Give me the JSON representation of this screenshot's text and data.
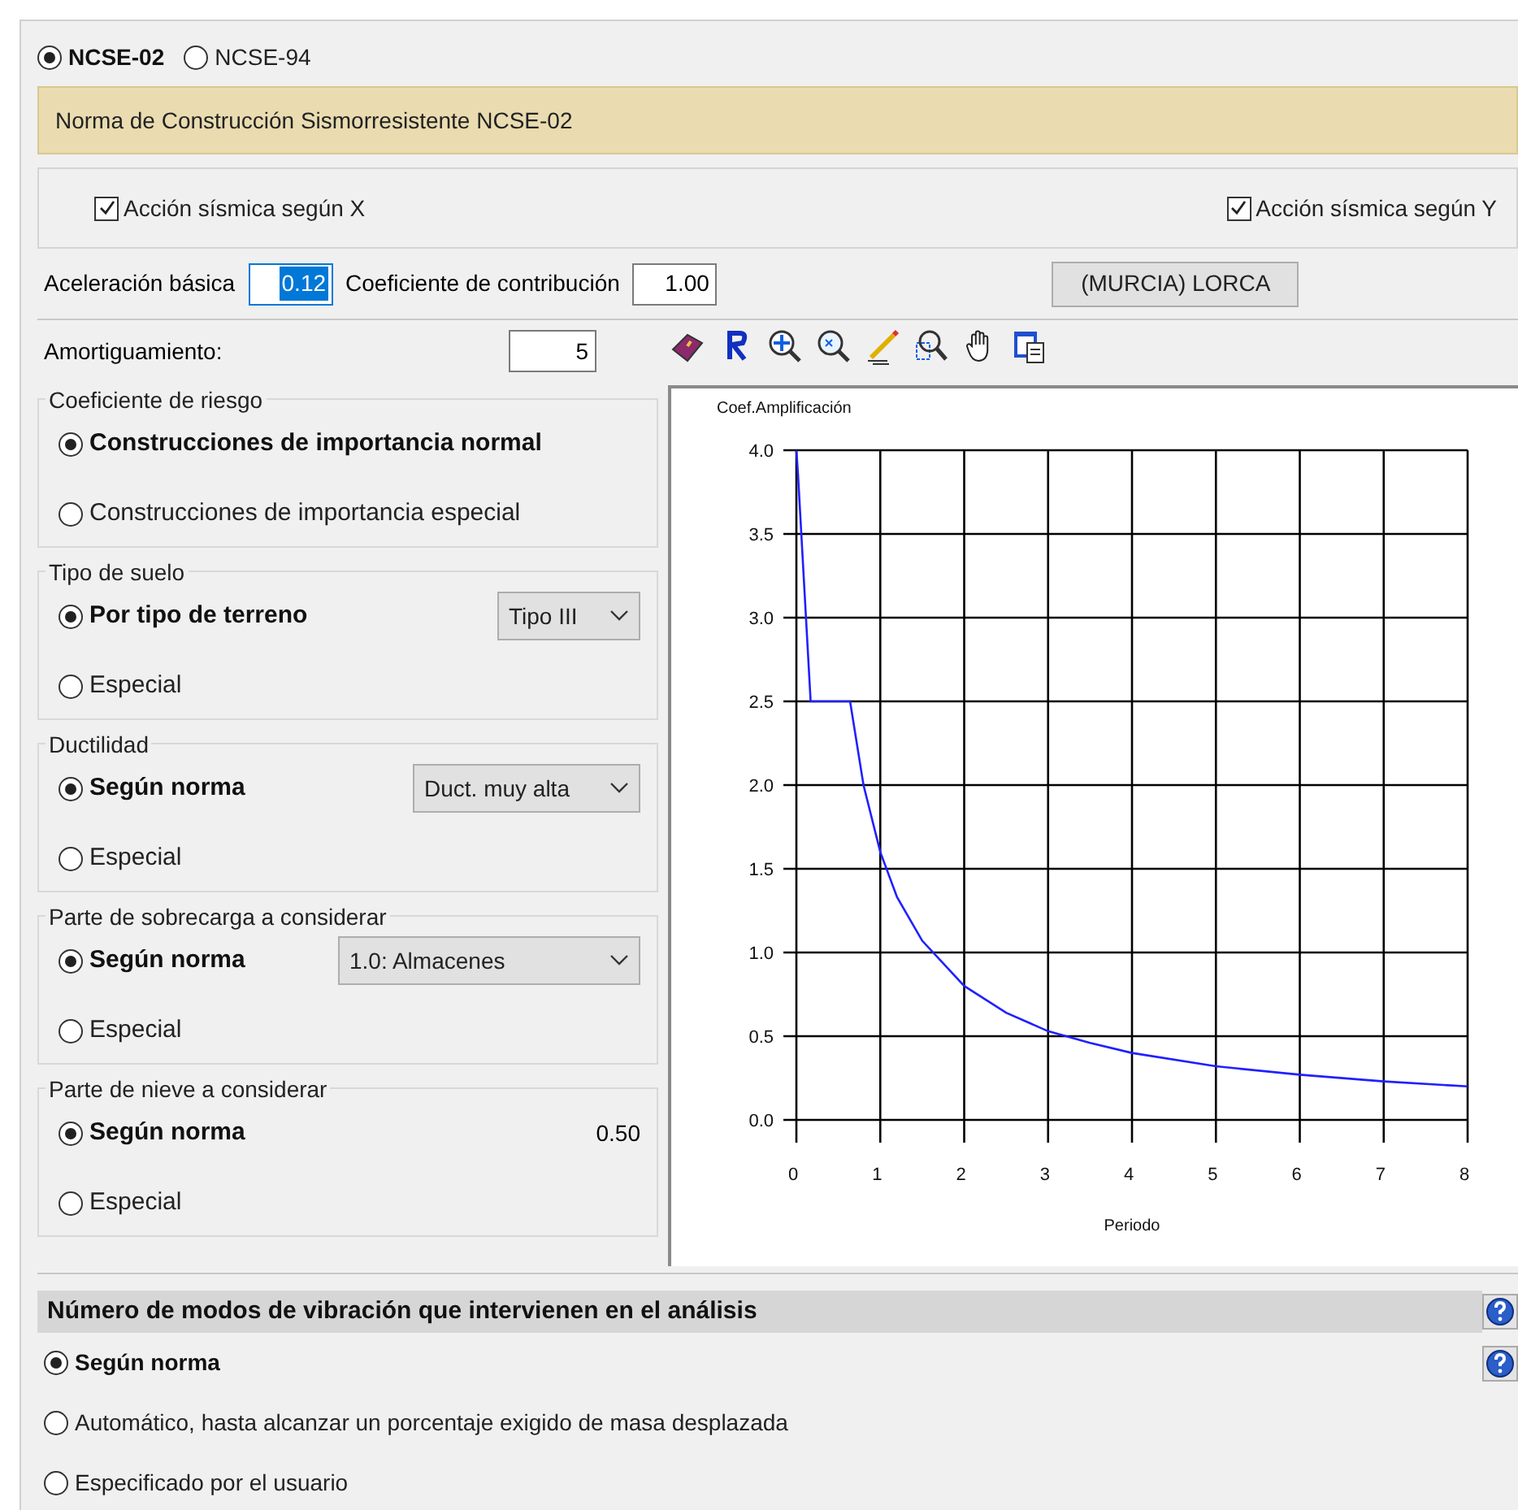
{
  "norm_options": [
    {
      "label": "NCSE-02",
      "selected": true
    },
    {
      "label": "NCSE-94",
      "selected": false
    }
  ],
  "norm_banner": "Norma de Construcción Sismorresistente NCSE-02",
  "seismic_actions": [
    {
      "label": "Acción sísmica según X",
      "checked": true
    },
    {
      "label": "Acción sísmica según Y",
      "checked": true
    }
  ],
  "basic_acceleration": {
    "label": "Aceleración básica",
    "value": "0.12",
    "highlighted": true
  },
  "contribution_coefficient": {
    "label": "Coeficiente de contribución",
    "value": "1.00"
  },
  "location_button": "(MURCIA) LORCA",
  "damping": {
    "label": "Amortiguamiento:",
    "value": "5"
  },
  "groups": [
    {
      "title": "Coeficiente de riesgo",
      "options": [
        {
          "label": "Construcciones de importancia normal",
          "selected": true
        },
        {
          "label": "Construcciones de importancia especial",
          "selected": false
        }
      ]
    },
    {
      "title": "Tipo de suelo",
      "options": [
        {
          "label": "Por tipo de terreno",
          "selected": true
        },
        {
          "label": "Especial",
          "selected": false
        }
      ],
      "accessory": {
        "kind": "dropdown",
        "text": "Tipo III"
      }
    },
    {
      "title": "Ductilidad",
      "options": [
        {
          "label": "Según norma",
          "selected": true
        },
        {
          "label": "Especial",
          "selected": false
        }
      ],
      "accessory": {
        "kind": "dropdown",
        "text": "Duct. muy alta"
      }
    },
    {
      "title": "Parte de sobrecarga a considerar",
      "options": [
        {
          "label": "Según norma",
          "selected": true
        },
        {
          "label": "Especial",
          "selected": false
        }
      ],
      "accessory": {
        "kind": "dropdown",
        "text": "1.0: Almacenes"
      }
    },
    {
      "title": "Parte de nieve a considerar",
      "options": [
        {
          "label": "Según norma",
          "selected": true
        },
        {
          "label": "Especial",
          "selected": false
        }
      ],
      "accessory": {
        "kind": "value",
        "text": "0.50"
      }
    }
  ],
  "chart": {
    "chart_data": {
      "type": "line",
      "xlabel": "Periodo",
      "ylabel": "Coef.Amplificación",
      "xlim": [
        0,
        8
      ],
      "ylim": [
        0,
        4
      ],
      "xticks": [
        0,
        1,
        2,
        3,
        4,
        5,
        6,
        7,
        8
      ],
      "yticks": [
        {
          "value": 0,
          "label": "0.0"
        },
        {
          "value": 0.5,
          "label": "0.5"
        },
        {
          "value": 1,
          "label": "1.0"
        },
        {
          "value": 1.5,
          "label": "1.5"
        },
        {
          "value": 2,
          "label": "2.0"
        },
        {
          "value": 2.5,
          "label": "2.5"
        },
        {
          "value": 3,
          "label": "3.0"
        },
        {
          "value": 3.5,
          "label": "3.5"
        },
        {
          "value": 4,
          "label": "4.0"
        }
      ],
      "x": [
        0,
        0.02,
        0.17,
        0.64,
        0.8,
        1,
        1.2,
        1.5,
        2,
        2.5,
        3,
        3.5,
        4,
        5,
        6,
        7,
        8
      ],
      "grid": true,
      "series": [
        {
          "color": "#2020ff",
          "values": [
            4.0,
            3.85,
            2.5,
            2.5,
            2.0,
            1.6,
            1.33,
            1.07,
            0.8,
            0.64,
            0.53,
            0.46,
            0.4,
            0.32,
            0.27,
            0.23,
            0.2
          ]
        }
      ]
    }
  },
  "modes_section": {
    "title": "Número de modos de vibración que intervienen en el análisis",
    "options": [
      {
        "label": "Según norma",
        "selected": true
      },
      {
        "label": "Automático, hasta alcanzar un porcentaje exigido de masa desplazada",
        "selected": false
      },
      {
        "label": "Especificado por el usuario",
        "selected": false
      }
    ]
  }
}
